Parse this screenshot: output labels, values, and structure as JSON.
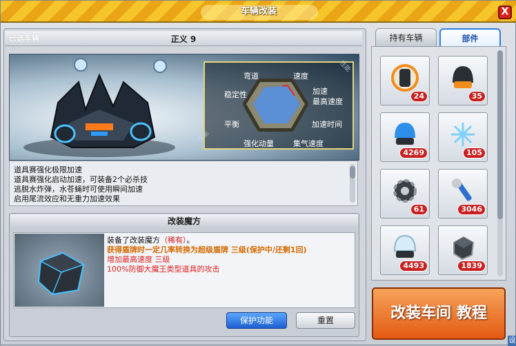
{
  "window": {
    "title": "车辆改装",
    "close_label": "X"
  },
  "vehicle": {
    "selected_label": "已选车辆",
    "name": "正义 9"
  },
  "stats": {
    "corner_tag_top": "性能",
    "corner_tag_side": "性能",
    "labels": {
      "cornering": "弯道",
      "speed": "速度",
      "stability": "稳定性",
      "acceleration": "加速",
      "top_speed": "最高速度",
      "balance": "平衡",
      "accel_time": "加速时间",
      "boost": "强化动量",
      "nitro_speed": "集气速度"
    }
  },
  "description": {
    "lines": [
      "道具赛强化极限加速",
      "道具赛强化启动加速，可装备2个必杀技",
      "逃脱水炸弹，水苍蝇时可使用瞬间加速",
      "启用尾流效应和无重力加速效果"
    ]
  },
  "modification": {
    "header": "改装魔方",
    "equipped_prefix": "装备了改装魔方",
    "equipped_rarity": "（稀有）",
    "equipped_suffix": "。",
    "effect_1": "获得盾牌时一定几率转换为超级盾牌 三级(保护中/还剩1回)",
    "effect_2": "增加最高速度 三级",
    "effect_3": "100%防御大魔王类型道具的攻击",
    "protect_button": "保护功能",
    "reset_button": "重置"
  },
  "tabs": {
    "owned": "持有车辆",
    "parts": "部件"
  },
  "parts": [
    {
      "icon": "engine-part-icon",
      "count": "24"
    },
    {
      "icon": "helmet-part-icon",
      "count": "35"
    },
    {
      "icon": "blue-dome-part-icon",
      "count": "4269"
    },
    {
      "icon": "spark-part-icon",
      "count": "105"
    },
    {
      "icon": "gear-part-icon",
      "count": "61"
    },
    {
      "icon": "wrench-part-icon",
      "count": "3046"
    },
    {
      "icon": "glass-dome-part-icon",
      "count": "4493"
    },
    {
      "icon": "cube-part-icon",
      "count": "1839"
    }
  ],
  "tutorial_button": "改装车间 教程",
  "corner_button": "设",
  "colors": {
    "title_stripe_a": "#f5c52a",
    "title_stripe_b": "#e9a516",
    "tab_active_border": "#2f7ee0",
    "badge": "#c91f1f",
    "rarity": "#d61d1d",
    "effect_orange": "#d66a00",
    "effect_red": "#e02020",
    "tutorial": "#e35a12"
  },
  "radar": {
    "fill": "#5a8fd6",
    "highlight": "#e02a2a"
  }
}
